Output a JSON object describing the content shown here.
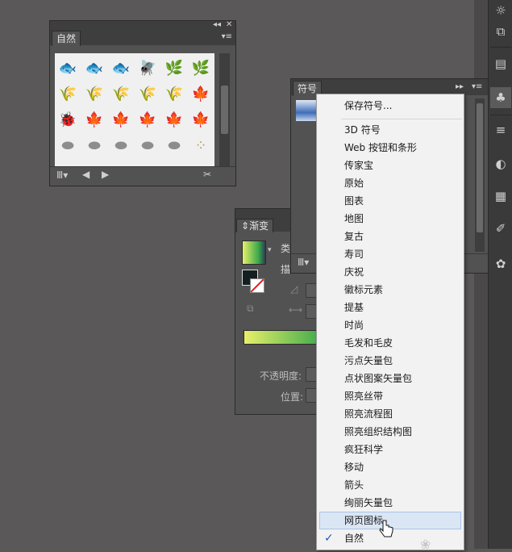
{
  "nature_panel": {
    "tab": "自然",
    "icons": [
      [
        "fish-icon",
        "fish-icon",
        "fish-icon",
        "fly-icon",
        "plant-icon",
        "plant-icon"
      ],
      [
        "grass-icon",
        "grass-icon",
        "grass-icon",
        "grass-icon",
        "grass-icon",
        "leaf-icon"
      ],
      [
        "ladybug-icon",
        "leaf-icon",
        "leaf-icon",
        "leaf-icon",
        "leaf-icon",
        "leaf-icon"
      ],
      [
        "stone-icon",
        "stone-icon",
        "stone-icon",
        "stone-icon",
        "stone-icon",
        "sand-icon"
      ]
    ]
  },
  "symbols_panel": {
    "tab": "符号"
  },
  "gradient_panel": {
    "tab": "渐变",
    "type_label": "类",
    "stroke_label": "描",
    "opacity_label": "不透明度:",
    "position_label": "位置:",
    "colors": {
      "gradient_start": "#e7f06a",
      "gradient_end": "#3aa84b"
    }
  },
  "menu": {
    "save": "保存符号...",
    "items": [
      "3D 符号",
      "Web 按钮和条形",
      "传家宝",
      "原始",
      "图表",
      "地图",
      "复古",
      "寿司",
      "庆祝",
      "徽标元素",
      "提基",
      "时尚",
      "毛发和毛皮",
      "污点矢量包",
      "点状图案矢量包",
      "照亮丝带",
      "照亮流程图",
      "照亮组织结构图",
      "疯狂科学",
      "移动",
      "箭头",
      "绚丽矢量包",
      "网页图标",
      "自然"
    ],
    "highlighted": "网页图标",
    "checked": "自然"
  }
}
